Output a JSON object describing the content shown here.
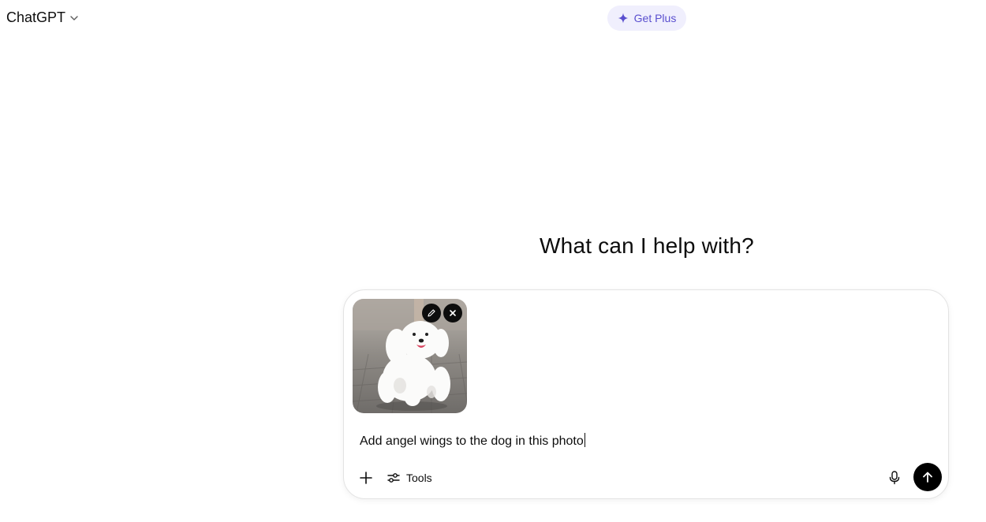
{
  "header": {
    "model_name": "ChatGPT",
    "upgrade_label": "Get Plus"
  },
  "main": {
    "heading": "What can I help with?"
  },
  "composer": {
    "attachment": {
      "description": "photo of a white fluffy dog running on pavement",
      "icons": [
        "pencil-icon",
        "close-icon"
      ]
    },
    "input_value": "Add angel wings to the dog in this photo",
    "tools_label": "Tools",
    "icons": [
      "plus-icon",
      "tools-icon",
      "microphone-icon",
      "arrow-up-icon"
    ]
  },
  "colors": {
    "accent": "#5a4fcf",
    "accent_bg": "#f0effd",
    "send_button": "#000000",
    "text": "#0d0d0d"
  }
}
